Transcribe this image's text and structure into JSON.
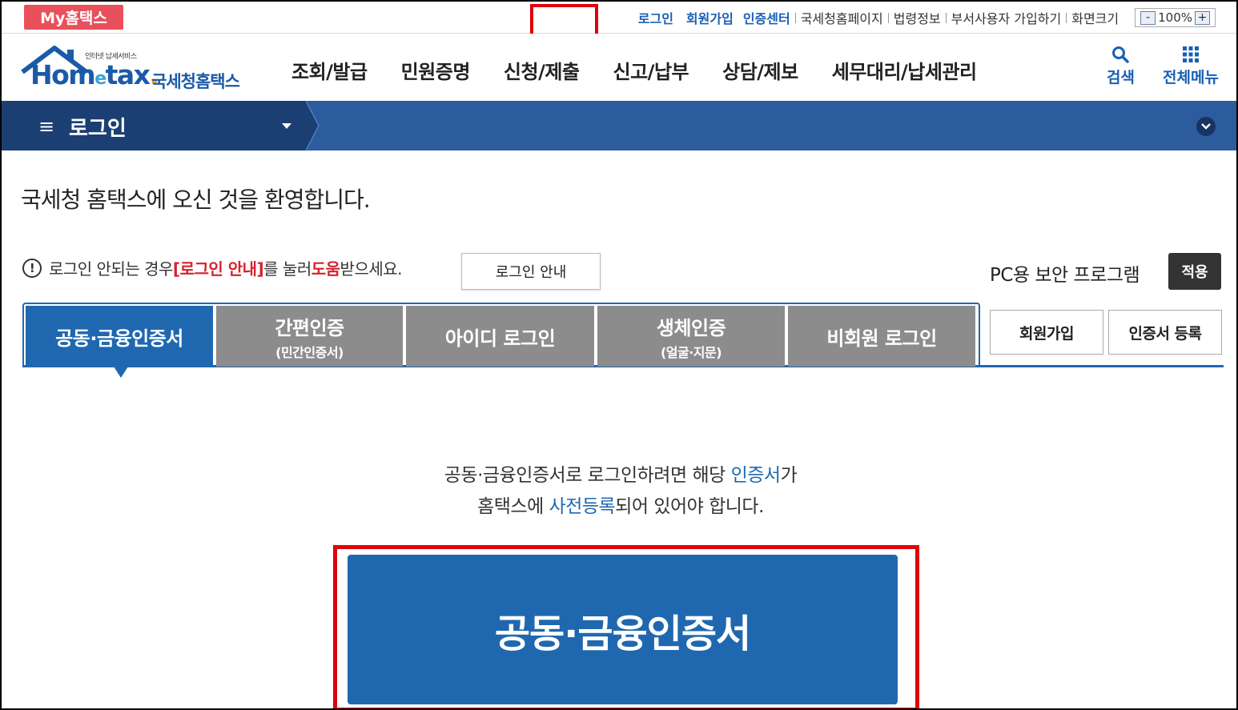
{
  "topbar": {
    "my_badge": "My홈택스",
    "links": {
      "login": "로그인",
      "signup": "회원가입",
      "cert_center": "인증센터",
      "nts_home": "국세청홈페이지",
      "law_info": "법령정보",
      "dept_user": "부서사용자 가입하기",
      "screen_size": "화면크기"
    },
    "zoom": {
      "minus": "-",
      "value": "100%",
      "plus": "+"
    }
  },
  "header": {
    "logo": {
      "small": "인터넷 납세서비스",
      "home": "Hom",
      "e": "e",
      "tax": "tax",
      "dot": ".",
      "korean": "국세청홈택스"
    },
    "gnb": [
      "조회/발급",
      "민원증명",
      "신청/제출",
      "신고/납부",
      "상담/제보",
      "세무대리/납세관리"
    ],
    "search_label": "검색",
    "allmenu_label": "전체메뉴"
  },
  "navbar": {
    "menu_icon": "≡",
    "title": "로그인"
  },
  "content": {
    "welcome": "국세청 홈택스에 오신 것을 환영합니다.",
    "help": {
      "icon": "!",
      "pre": "로그인 안되는 경우 ",
      "link": "[로그인 안내]",
      "mid": "를 눌러 ",
      "help_word": "도움",
      "post": "받으세요."
    },
    "help_button": "로그인 안내",
    "security_label": "PC용 보안 프로그램",
    "security_button": "적용",
    "tabs": [
      {
        "label": "공동·금융인증서",
        "sub": ""
      },
      {
        "label": "간편인증",
        "sub": "(민간인증서)"
      },
      {
        "label": "아이디 로그인",
        "sub": ""
      },
      {
        "label": "생체인증",
        "sub": "(얼굴·지문)"
      },
      {
        "label": "비회원 로그인",
        "sub": ""
      }
    ],
    "side_buttons": {
      "signup": "회원가입",
      "cert_register": "인증서 등록"
    },
    "desc_line1": {
      "pre": "공동·금융인증서로 로그인하려면 해당 ",
      "hl": "인증서",
      "post": "가"
    },
    "desc_line2": {
      "pre": "홈택스에 ",
      "hl": "사전등록",
      "post": "되어 있어야 합니다."
    },
    "main_button": "공동·금융인증서"
  },
  "colors": {
    "brand_blue": "#1f68b0",
    "nav_dark": "#1c3f73",
    "nav_blue": "#2d5c9e",
    "highlight_red": "#e0000b",
    "tab_gray": "#8c8c8c",
    "badge_red": "#e8505b"
  },
  "icons": {
    "search": "search-icon",
    "allmenu": "grid-icon",
    "collapse": "chevron-down-icon",
    "alert": "exclamation-circle-icon"
  }
}
